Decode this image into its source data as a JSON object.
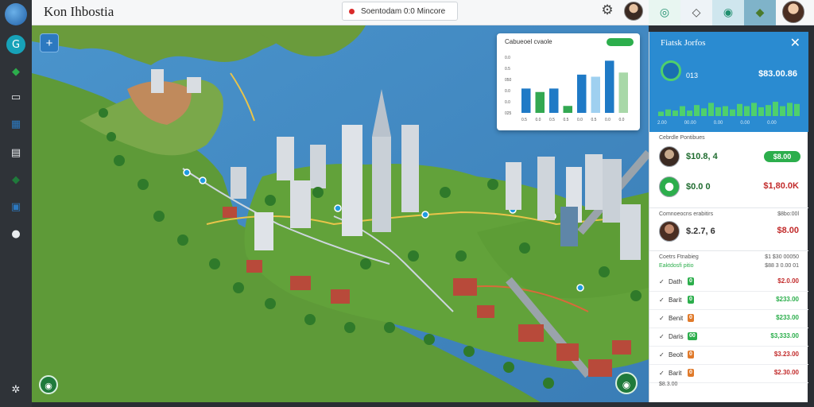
{
  "app": {
    "title": "Kon Ihbostia"
  },
  "status": {
    "label": "Soentodam 0:0 Mincore",
    "color": "#d92b2b"
  },
  "sidebar": {
    "icons": [
      {
        "name": "globe-logo-icon",
        "glyph": "",
        "color": "#2c79c0"
      },
      {
        "name": "badge-g-icon",
        "glyph": "G",
        "color": "#17a2b8"
      },
      {
        "name": "cube-icon",
        "glyph": "◆",
        "color": "#2cae4c"
      },
      {
        "name": "card-icon",
        "glyph": "▭",
        "color": "#e9ecef"
      },
      {
        "name": "grid-icon",
        "glyph": "▦",
        "color": "#2c79c0"
      },
      {
        "name": "folder-icon",
        "glyph": "▤",
        "color": "#e9ecef"
      },
      {
        "name": "leaf-icon",
        "glyph": "◆",
        "color": "#1f7a3b"
      },
      {
        "name": "device-icon",
        "glyph": "▣",
        "color": "#2c79c0"
      },
      {
        "name": "ball-icon",
        "glyph": "●",
        "color": "#e9ecef"
      },
      {
        "name": "share-icon",
        "glyph": "✲",
        "color": "#e9ecef"
      }
    ]
  },
  "topbar_tabs": [
    {
      "name": "tab-routes",
      "glyph": "◎",
      "bg": "#e8f6f1",
      "color": "#1f8f6e"
    },
    {
      "name": "tab-shapes",
      "glyph": "◇",
      "bg": "#eef3f7",
      "color": "#444"
    },
    {
      "name": "tab-network",
      "glyph": "◉",
      "bg": "#cfe6ee",
      "color": "#1f8f6e"
    },
    {
      "name": "tab-region",
      "glyph": "◆",
      "bg": "#7fb3c9",
      "color": "#4a7a2b"
    }
  ],
  "map": {
    "zoom_label": "+",
    "bottom_left_label": "◉",
    "bottom_right_label": "◉"
  },
  "mini_chart": {
    "title": "Cabueoel cvaole",
    "ticks_y": [
      "025",
      "0.0",
      "0.0",
      "050",
      "0.5",
      "0.0"
    ],
    "ticks_x": [
      "0.5",
      "0.0",
      "0.5",
      "0.5",
      "0.0",
      "0.5",
      "0.0",
      "0.0"
    ],
    "chart_data": {
      "type": "bar",
      "series": [
        {
          "values": [
            35,
            0,
            35,
            10,
            55,
            0,
            55,
            0
          ]
        },
        {
          "values": [
            0,
            30,
            0,
            0,
            0,
            0,
            0,
            0
          ]
        },
        {
          "values": [
            0,
            0,
            0,
            0,
            0,
            52,
            0,
            58
          ]
        },
        {
          "values": [
            0,
            0,
            0,
            30,
            0,
            0,
            0,
            0
          ]
        }
      ],
      "values": [
        35,
        30,
        35,
        10,
        55,
        52,
        75,
        58
      ],
      "colors": [
        "#1f7ac6",
        "#33a852",
        "#1f7ac6",
        "#33a852",
        "#1f7ac6",
        "#9fd0f0",
        "#1f7ac6",
        "#a8d8a8"
      ],
      "ylim": [
        0,
        80
      ]
    }
  },
  "panel": {
    "title": "Fiatsk Jorfos",
    "summary": {
      "label": "013",
      "value": "$83.00.86",
      "footer": [
        "2.00",
        "00.00",
        "0.00",
        "0.00",
        "0.00"
      ]
    },
    "summary_spark": [
      4,
      6,
      5,
      9,
      5,
      10,
      7,
      12,
      8,
      9,
      6,
      11,
      9,
      12,
      8,
      10,
      13,
      9,
      12,
      11
    ],
    "people": [
      {
        "section": "Cebrdle Pontibues",
        "name": "$10.8, 4",
        "pill": "$8.00",
        "face": "#c6a98c"
      },
      {
        "section": "",
        "name": "$0.0 0",
        "value": "$1,80.0K",
        "face": "#2cae4c"
      }
    ],
    "third": {
      "section": "Comnoeocns erabitirs",
      "section_right": "$8bo:00l",
      "name": "$.2.7, 6",
      "value": "$8.00",
      "face": "#c08a6e"
    },
    "list_header": {
      "left": "Coetrs Ftnabieg",
      "sub": "Eaktdosfi pitio",
      "right": "$1 $30 00050",
      "right_sub": "$88 3 0.00 01"
    },
    "transactions": [
      {
        "name": "Dath",
        "tag": "0",
        "tag_color": "#2cae4c",
        "amount": "$2.0.00",
        "amount_color": "#c22b2b"
      },
      {
        "name": "Barit",
        "tag": "0",
        "tag_color": "#2cae4c",
        "amount": "$233.00",
        "amount_color": "#2cae4c"
      },
      {
        "name": "Benit",
        "tag": "0",
        "tag_color": "#e07a2b",
        "amount": "$233.00",
        "amount_color": "#2cae4c"
      },
      {
        "name": "Daris",
        "tag": "00",
        "tag_color": "#2cae4c",
        "amount": "$3,333.00",
        "amount_color": "#2cae4c"
      },
      {
        "name": "Beolt",
        "tag": "0",
        "tag_color": "#e07a2b",
        "amount": "$3.23.00",
        "amount_color": "#c22b2b"
      },
      {
        "name": "Barit",
        "tag": "0",
        "tag_color": "#e07a2b",
        "amount": "$2.30.00",
        "amount_color": "#c22b2b"
      }
    ],
    "footer_row": "$8.3.00"
  }
}
